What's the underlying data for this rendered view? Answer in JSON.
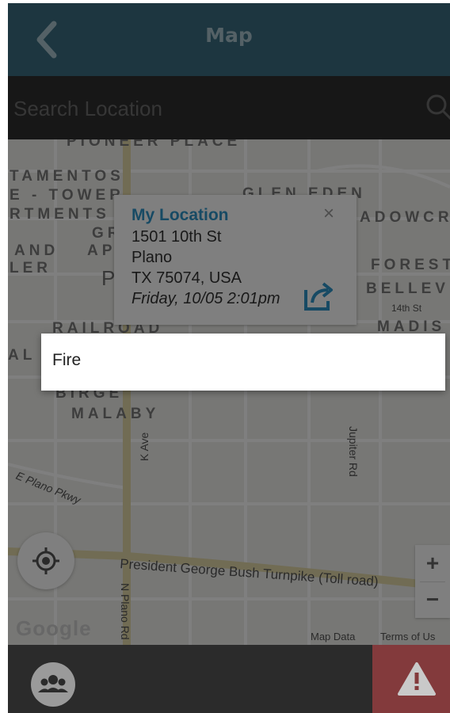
{
  "header": {
    "title": "Map",
    "back_icon": "chevron-left-icon"
  },
  "search": {
    "placeholder": "Search Location",
    "icon": "search-icon"
  },
  "map": {
    "neighborhood_labels": [
      "PIONEER PLACE",
      "TAMENTOS",
      "E - TOWER",
      "RTMENTS",
      "GLEN EDEN",
      "ADOWCR",
      "AND",
      "LER",
      "FOREST",
      "BELLEV",
      "RAILROAD",
      "MADIS",
      "BIRGE",
      "MALABY",
      "GR",
      "AP",
      "P",
      "AL",
      "T"
    ],
    "street_labels": [
      "14th St",
      "Jupiter Rd",
      "K Ave",
      "E Plano Pkwy",
      "President George Bush Turnpike (Toll road)",
      "N Plano Rd"
    ],
    "info_window": {
      "title": "My Location",
      "address_line1": "1501 10th St",
      "address_line2": "Plano",
      "address_line3": "TX 75074, USA",
      "timestamp": "Friday, 10/05 2:01pm",
      "close_label": "×",
      "share_icon": "share-icon"
    },
    "zoom_in_label": "+",
    "zoom_out_label": "−",
    "logo_text": "Google",
    "map_data_label": "Map Data",
    "terms_label": "Terms of Us",
    "locate_icon": "locate-me-icon"
  },
  "bottom_bar": {
    "group_icon": "group-icon",
    "alert_icon": "alert-icon"
  },
  "menu": {
    "items": [
      "Fire"
    ]
  },
  "colors": {
    "header_bg": "#3a6d80",
    "accent_blue": "#2f95c8",
    "alert_red": "#d9534f",
    "overlay": "rgba(0,0,0,0.5)"
  }
}
